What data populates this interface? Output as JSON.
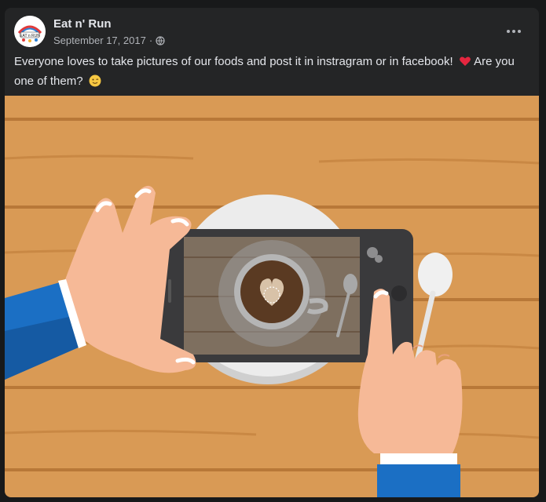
{
  "post": {
    "page_name": "Eat n' Run",
    "date": "September 17, 2017",
    "separator": "·",
    "privacy_icon": "globe-icon",
    "more_icon": "more-options-icon",
    "caption_part1": "Everyone loves to take pictures of our foods and post it in instragram or in facebook!",
    "caption_part2": " Are you one of them?",
    "emoji_1": "red-heart-emoji",
    "emoji_2": "winking-face-emoji",
    "avatar_logo": "eat-n-run-logo",
    "photo": "illustration-hands-phone-photographing-coffee"
  },
  "colors": {
    "background": "#18191a",
    "card": "#242526",
    "text_primary": "#e4e6eb",
    "text_secondary": "#b0b3b8",
    "table_wood": "#d99a55",
    "sleeve_blue": "#1b6fc4"
  }
}
